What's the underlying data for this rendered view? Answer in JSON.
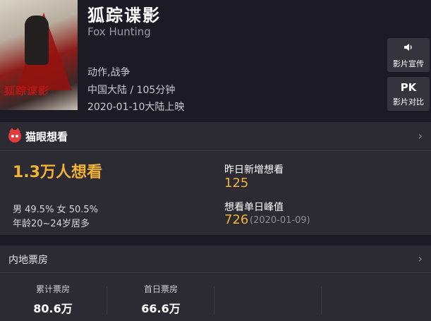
{
  "movie": {
    "poster_title": "狐踪谍影",
    "title": "狐踪谍影",
    "english_title": "Fox Hunting",
    "genre": "动作,战争",
    "region_duration": "中国大陆 / 105分钟",
    "release": "2020-01-10大陆上映"
  },
  "side_buttons": {
    "promo_glyph": "◁⦚",
    "promo_label": "影片宣传",
    "compare_glyph": "PK",
    "compare_label": "影片对比"
  },
  "want_card": {
    "title": "猫眼想看",
    "chevron": "›",
    "total_want": "1.3万人想看",
    "gender_split": "男 49.5% 女 50.5%",
    "age": "年龄20~24岁居多",
    "new_yesterday_label": "昨日新增想看",
    "new_yesterday_value": "125",
    "peak_label": "想看单日峰值",
    "peak_value": "726",
    "peak_date": "(2020-01-09)"
  },
  "box_office": {
    "title": "内地票房",
    "chevron": "›",
    "cumulative_label": "累计票房",
    "cumulative_value": "80.6万",
    "first_day_label": "首日票房",
    "first_day_value": "66.6万"
  },
  "colors": {
    "accent": "#f2b233",
    "background": "#1b1a25",
    "card": "#2c2b34"
  }
}
